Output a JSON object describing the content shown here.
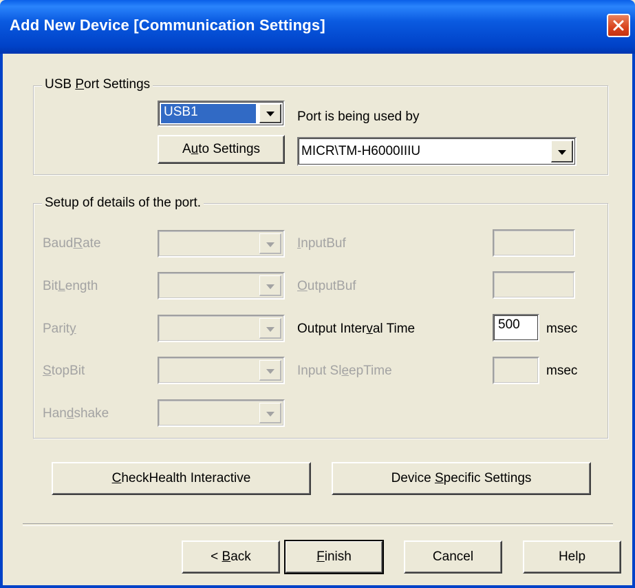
{
  "window": {
    "title": "Add New Device  [Communication Settings]"
  },
  "usb_group": {
    "label_pre": "USB ",
    "label_u": "P",
    "label_post": "ort Settings",
    "port_value": "USB1",
    "port_used_label": "Port is being used by",
    "auto_pre": "A",
    "auto_u": "u",
    "auto_post": "to Settings",
    "device_value": "MICR\\TM-H6000IIIU"
  },
  "details_group": {
    "label": "Setup of details of the port.",
    "baud": {
      "pre": "Baud",
      "u": "R",
      "post": "ate"
    },
    "bitlength": {
      "pre": "Bit",
      "u": "L",
      "post": "ength"
    },
    "parity": {
      "pre": "Parit",
      "u": "y",
      "post": ""
    },
    "stopbit": {
      "pre": "",
      "u": "S",
      "post": "topBit"
    },
    "handshake": {
      "pre": "Han",
      "u": "d",
      "post": "shake"
    },
    "inputbuf": {
      "pre": "",
      "u": "I",
      "post": "nputBuf"
    },
    "outputbuf": {
      "pre": "",
      "u": "O",
      "post": "utputBuf"
    },
    "output_interval": {
      "pre": "Output Inter",
      "u": "v",
      "post": "al Time",
      "value": "500",
      "unit": "msec"
    },
    "input_sleep": {
      "pre": "Input Sl",
      "u": "e",
      "post": "epTime",
      "unit": "msec"
    }
  },
  "buttons": {
    "checkhealth": {
      "pre": "",
      "u": "C",
      "post": "heckHealth Interactive"
    },
    "device_specific": {
      "pre": "Device ",
      "u": "S",
      "post": "pecific Settings"
    },
    "back": {
      "pre": "< ",
      "u": "B",
      "post": "ack"
    },
    "finish": {
      "pre": "",
      "u": "F",
      "post": "inish"
    },
    "cancel": "Cancel",
    "help": "Help"
  },
  "colors": {
    "titlebar": "#0a5ae0",
    "face": "#ece9d8",
    "selection": "#316ac5",
    "close": "#d9441e"
  }
}
